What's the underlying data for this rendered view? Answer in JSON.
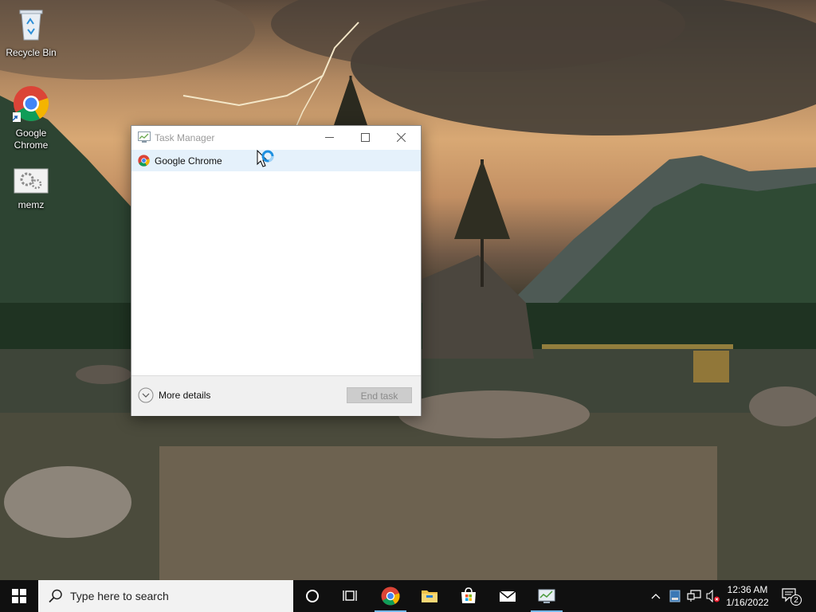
{
  "desktop": {
    "icons": [
      {
        "label": "Recycle Bin",
        "icon": "recycle-bin-icon"
      },
      {
        "label": "Google\nChrome",
        "label_line1": "Google",
        "label_line2": "Chrome",
        "icon": "chrome-icon"
      },
      {
        "label": "memz",
        "icon": "memz-icon"
      }
    ]
  },
  "task_manager": {
    "title": "Task Manager",
    "processes": [
      {
        "name": "Google Chrome",
        "icon": "chrome-icon",
        "selected": true
      }
    ],
    "more_details_label": "More details",
    "end_task_label": "End task",
    "end_task_enabled": false
  },
  "taskbar": {
    "search_placeholder": "Type here to search",
    "pinned": [
      "cortana-icon",
      "task-view-icon",
      "chrome-icon",
      "file-explorer-icon",
      "store-icon",
      "mail-icon",
      "task-manager-icon"
    ],
    "clock_time": "12:36 AM",
    "clock_date": "1/16/2022",
    "notification_count": "2"
  },
  "colors": {
    "taskbar": "#101010",
    "selection": "#e5f1fb",
    "accent": "#76b9ed"
  }
}
